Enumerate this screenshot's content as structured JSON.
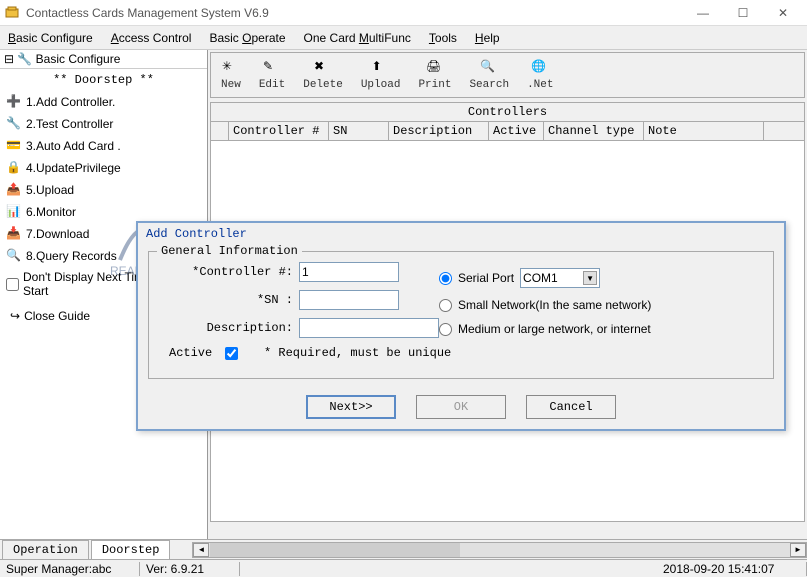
{
  "window": {
    "title": "Contactless Cards Management System  V6.9",
    "buttons": {
      "min": "—",
      "max": "☐",
      "close": "✕"
    }
  },
  "menubar": {
    "items": [
      {
        "pre": "",
        "u": "B",
        "post": "asic Configure"
      },
      {
        "pre": "",
        "u": "A",
        "post": "ccess Control"
      },
      {
        "pre": "Basic ",
        "u": "O",
        "post": "perate"
      },
      {
        "pre": "One Card ",
        "u": "M",
        "post": "ultiFunc"
      },
      {
        "pre": "",
        "u": "T",
        "post": "ools"
      },
      {
        "pre": "",
        "u": "H",
        "post": "elp"
      }
    ]
  },
  "leftpanel": {
    "header1": "Basic Configure",
    "header2": "** Doorstep **",
    "items": [
      "1.Add Controller.",
      "2.Test Controller",
      "3.Auto Add Card .",
      "4.UpdatePrivilege",
      "5.Upload",
      "6.Monitor",
      "7.Download",
      "8.Query Records"
    ],
    "noDisplay": "Don't Display Next Time Start",
    "close": "Close Guide",
    "watermark": "REALHELP"
  },
  "toolbar": {
    "items": [
      "New",
      "Edit",
      "Delete",
      "Upload",
      "Print",
      "Search",
      ".Net"
    ]
  },
  "table": {
    "title": "Controllers",
    "columns": [
      "Controller #",
      "SN",
      "Description",
      "Active",
      "Channel type",
      "Note"
    ]
  },
  "dialog": {
    "title": "Add Controller",
    "legend": "General Information",
    "labels": {
      "controller": "*Controller #:",
      "sn": "*SN :",
      "desc": "Description:",
      "active": "Active",
      "reqnote": "*  Required, must be unique"
    },
    "values": {
      "controller": "1",
      "sn": "",
      "desc": "",
      "activeChecked": true
    },
    "radios": {
      "serial": "Serial Port",
      "serialCombo": "COM1",
      "small": "Small Network(In the same network)",
      "medium": "Medium or large network, or internet"
    },
    "buttons": {
      "next": "Next>>",
      "ok": "OK",
      "cancel": "Cancel"
    }
  },
  "bottomTabs": {
    "tab1": "Operation",
    "tab2": "Doorstep"
  },
  "statusbar": {
    "user": "Super Manager:abc",
    "ver": "Ver: 6.9.21",
    "datetime": "2018-09-20 15:41:07"
  }
}
